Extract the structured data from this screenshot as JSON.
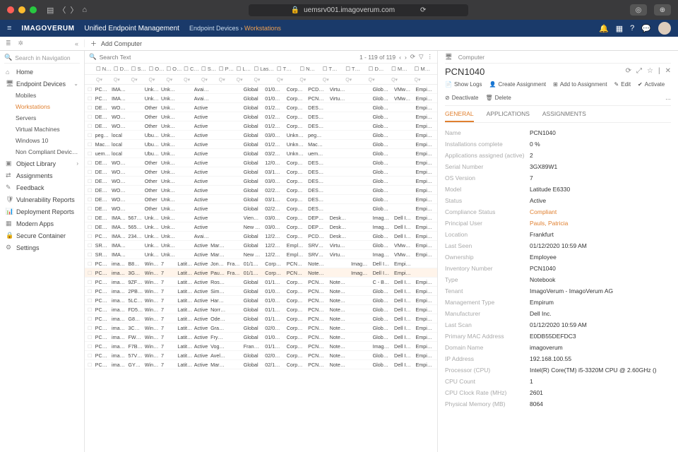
{
  "chrome": {
    "url": "uemsrv001.imagoverum.com"
  },
  "appbar": {
    "brand": "IMAGOVERUM",
    "title": "Unified Endpoint Management",
    "crumb1": "Endpoint Devices",
    "crumb2": "Workstations"
  },
  "add_button": "Add Computer",
  "search_placeholder": "Search in Navigation",
  "list_search": "Search Text",
  "paging": "1 - 119 of 119",
  "sidebar": {
    "home": "Home",
    "endpoint": "Endpoint Devices",
    "mobiles": "Mobiles",
    "workstations": "Workstations",
    "servers": "Servers",
    "vm": "Virtual Machines",
    "win10": "Windows 10",
    "noncomp": "Non Compliant Devic…",
    "objlib": "Object Library",
    "assign": "Assignments",
    "feedback": "Feedback",
    "vuln": "Vulnerability Reports",
    "deploy": "Deployment Reports",
    "modern": "Modern Apps",
    "secure": "Secure Container",
    "settings": "Settings"
  },
  "columns": [
    "N…",
    "D…",
    "S…",
    "O…",
    "O…",
    "C…",
    "S…",
    "P…",
    "L…",
    "Last…",
    "T…",
    "N…",
    "T…",
    "T…",
    "D…",
    "M…",
    "M…"
  ],
  "filter_ph": "Q▾",
  "rows": [
    [
      "PCD…",
      "IMA…",
      "",
      "Unkn…",
      "Unkn…",
      "",
      "Avail…",
      "",
      "",
      "Global",
      "01/0…",
      "Corp…",
      "PCD…",
      "Virtu…",
      "",
      "Glob…",
      "VMw…",
      "Empi…"
    ],
    [
      "PCN…",
      "IMA…",
      "",
      "Unkn…",
      "Unkn…",
      "",
      "Avail…",
      "",
      "",
      "Global",
      "01/0…",
      "Corp…",
      "PCN…",
      "Virtu…",
      "",
      "Glob…",
      "VMw…",
      "Empi…"
    ],
    [
      "DES…",
      "WOR…",
      "",
      "Other",
      "Unkn…",
      "",
      "Active",
      "",
      "",
      "Global",
      "01/2…",
      "Corp…",
      "DES…",
      "",
      "",
      "Glob…",
      "",
      "Empi…"
    ],
    [
      "DES…",
      "WOR…",
      "",
      "Other",
      "Unkn…",
      "",
      "Active",
      "",
      "",
      "Global",
      "01/2…",
      "Corp…",
      "DES…",
      "",
      "",
      "Glob…",
      "",
      "Empi…"
    ],
    [
      "DES…",
      "WOR…",
      "",
      "Other",
      "Unkn…",
      "",
      "Active",
      "",
      "",
      "Global",
      "01/2…",
      "Corp…",
      "DES…",
      "",
      "",
      "Glob…",
      "",
      "Empi…"
    ],
    [
      "peg…",
      "local",
      "",
      "Ubun…",
      "Unkn…",
      "",
      "Active",
      "",
      "",
      "Global",
      "03/0…",
      "Unkn…",
      "peg…",
      "",
      "",
      "Glob…",
      "",
      "Empi…"
    ],
    [
      "Mac…",
      "local",
      "",
      "Ubun…",
      "Unkn…",
      "",
      "Active",
      "",
      "",
      "Global",
      "01/2…",
      "Unkn…",
      "Mac…",
      "",
      "",
      "Glob…",
      "",
      "Empi…"
    ],
    [
      "uem…",
      "local",
      "",
      "Ubun…",
      "Unkn…",
      "",
      "Active",
      "",
      "",
      "Global",
      "03/2…",
      "Unkn…",
      "uem…",
      "",
      "",
      "Glob…",
      "",
      "Empi…"
    ],
    [
      "DES…",
      "WOR…",
      "",
      "Other",
      "Unkn…",
      "",
      "Active",
      "",
      "",
      "Global",
      "12/0…",
      "Corp…",
      "DES…",
      "",
      "",
      "Glob…",
      "",
      "Empi…"
    ],
    [
      "DES…",
      "WOR…",
      "",
      "Other",
      "Unkn…",
      "",
      "Active",
      "",
      "",
      "Global",
      "03/1…",
      "Corp…",
      "DES…",
      "",
      "",
      "Glob…",
      "",
      "Empi…"
    ],
    [
      "DES…",
      "WOR…",
      "",
      "Other",
      "Unkn…",
      "",
      "Active",
      "",
      "",
      "Global",
      "03/0…",
      "Corp…",
      "DES…",
      "",
      "",
      "Glob…",
      "",
      "Empi…"
    ],
    [
      "DES…",
      "WOR…",
      "",
      "Other",
      "Unkn…",
      "",
      "Active",
      "",
      "",
      "Global",
      "02/2…",
      "Corp…",
      "DES…",
      "",
      "",
      "Glob…",
      "",
      "Empi…"
    ],
    [
      "DES…",
      "WOR…",
      "",
      "Other",
      "Unkn…",
      "",
      "Active",
      "",
      "",
      "Global",
      "03/1…",
      "Corp…",
      "DES…",
      "",
      "",
      "Glob…",
      "",
      "Empi…"
    ],
    [
      "DES…",
      "WOR…",
      "",
      "Other",
      "Unkn…",
      "",
      "Active",
      "",
      "",
      "Global",
      "02/2…",
      "Corp…",
      "DES…",
      "",
      "",
      "Glob…",
      "",
      "Empi…"
    ],
    [
      "DEP…",
      "IMA…",
      "5675…",
      "Unkn…",
      "Unkn…",
      "",
      "Active",
      "",
      "",
      "Vien…",
      "03/0…",
      "Corp…",
      "DEP…",
      "Desk…",
      "",
      "Imag…",
      "Dell I…",
      "Empi…"
    ],
    [
      "DEP…",
      "IMA…",
      "5657…",
      "Unkn…",
      "Unkn…",
      "",
      "Active",
      "",
      "",
      "New …",
      "03/0…",
      "Corp…",
      "DEP…",
      "Desk…",
      "",
      "Imag…",
      "Dell I…",
      "Empi…"
    ],
    [
      "PCD…",
      "IMA…",
      "2344…",
      "Unkn…",
      "Unkn…",
      "",
      "Avail…",
      "",
      "",
      "Global",
      "12/2…",
      "Corp…",
      "PCD…",
      "Desk…",
      "",
      "Glob…",
      "Dell I…",
      "Empi…"
    ],
    [
      "SRV…",
      "IMA…",
      "",
      "Unkn…",
      "Unkn…",
      "",
      "Active",
      "Marv…",
      "",
      "Global",
      "12/2…",
      "Empl…",
      "SRV…",
      "Virtu…",
      "",
      "Glob…",
      "VMw…",
      "Empi…"
    ],
    [
      "SRV…",
      "IMA…",
      "",
      "Unkn…",
      "Unkn…",
      "",
      "Active",
      "Marv…",
      "",
      "New …",
      "12/2…",
      "Empl…",
      "SRV…",
      "Virtu…",
      "",
      "Imag…",
      "VMw…",
      "Empi…"
    ],
    [
      "PCN…",
      "imag…",
      "B8Q…",
      "Wind…",
      "7",
      "Latit…",
      "Active",
      "Jone…",
      "Fran…",
      "01/1…",
      "Corp…",
      "PCN…",
      "Note…",
      "",
      "Imag…",
      "Dell I…",
      "Empi…",
      ""
    ],
    [
      "PCN…",
      "imag…",
      "3GX…",
      "Wind…",
      "7",
      "Latit…",
      "Active",
      "Paul…",
      "Fran…",
      "01/1…",
      "Corp…",
      "PCN…",
      "Note…",
      "",
      "Imag…",
      "Dell I…",
      "Empi…",
      ""
    ],
    [
      "PCN…",
      "imag…",
      "9ZF3…",
      "Wind…",
      "7",
      "Latit…",
      "Active",
      "Ross…",
      "",
      "Global",
      "01/1…",
      "Corp…",
      "PCN…",
      "Note…",
      "",
      "C - B…",
      "Dell I…",
      "Empi…"
    ],
    [
      "PCN…",
      "imag…",
      "2PB…",
      "Wind…",
      "7",
      "Latit…",
      "Active",
      "Simp…",
      "",
      "Global",
      "01/0…",
      "Corp…",
      "PCN…",
      "Note…",
      "",
      "Glob…",
      "Dell I…",
      "Empi…"
    ],
    [
      "PCN…",
      "imag…",
      "5LC4…",
      "Wind…",
      "7",
      "Latit…",
      "Active",
      "Harv…",
      "",
      "Global",
      "01/0…",
      "Corp…",
      "PCN…",
      "Note…",
      "",
      "Glob…",
      "Dell I…",
      "Empi…"
    ],
    [
      "PCN…",
      "imag…",
      "FD5…",
      "Wind…",
      "7",
      "Latit…",
      "Active",
      "Norri…",
      "",
      "Global",
      "01/1…",
      "Corp…",
      "PCN…",
      "Note…",
      "",
      "Glob…",
      "Dell I…",
      "Empi…"
    ],
    [
      "PCN…",
      "imag…",
      "G8G…",
      "Wind…",
      "7",
      "Latit…",
      "Active",
      "Odell…",
      "",
      "Global",
      "01/1…",
      "Corp…",
      "PCN…",
      "Note…",
      "",
      "Glob…",
      "Dell I…",
      "Empi…"
    ],
    [
      "PCN…",
      "imag…",
      "3CN…",
      "Wind…",
      "7",
      "Latit…",
      "Active",
      "Gran…",
      "",
      "Global",
      "02/0…",
      "Corp…",
      "PCN…",
      "Note…",
      "",
      "Glob…",
      "Dell I…",
      "Empi…"
    ],
    [
      "PCN…",
      "imag…",
      "FW7…",
      "Wind…",
      "7",
      "Latit…",
      "Active",
      "Fryer…",
      "",
      "Global",
      "01/0…",
      "Corp…",
      "PCN…",
      "Note…",
      "",
      "Glob…",
      "Dell I…",
      "Empi…"
    ],
    [
      "PCN…",
      "imag…",
      "F7B4…",
      "Wind…",
      "7",
      "Latit…",
      "Active",
      "Voge…",
      "",
      "Fran…",
      "01/1…",
      "Corp…",
      "PCN…",
      "Note…",
      "",
      "Imag…",
      "Dell I…",
      "Empi…"
    ],
    [
      "PCN…",
      "imag…",
      "57V2…",
      "Wind…",
      "7",
      "Latit…",
      "Active",
      "Avel…",
      "",
      "Global",
      "02/0…",
      "Corp…",
      "PCN…",
      "Note…",
      "",
      "Glob…",
      "Dell I…",
      "Empi…"
    ],
    [
      "PCN…",
      "imag…",
      "GY2…",
      "Wind…",
      "7",
      "Latit…",
      "Active",
      "Mary…",
      "",
      "Global",
      "02/1…",
      "Corp…",
      "PCN…",
      "Note…",
      "",
      "Glob…",
      "Dell I…",
      "Empi…"
    ]
  ],
  "selected_row": 20,
  "detail": {
    "crumb": "Computer",
    "title": "PCN1040",
    "actions": {
      "show_logs": "Show Logs",
      "create_assign": "Create Assignment",
      "add_assign": "Add to Assignment",
      "edit": "Edit",
      "activate": "Activate",
      "deactivate": "Deactivate",
      "delete": "Delete"
    },
    "tabs": {
      "general": "GENERAL",
      "apps": "APPLICATIONS",
      "assigns": "ASSIGNMENTS"
    },
    "props": [
      {
        "k": "Name",
        "v": "PCN1040"
      },
      {
        "k": "Installations complete",
        "v": "0 %"
      },
      {
        "k": "Applications assigned (active)",
        "v": "2"
      },
      {
        "k": "Serial Number",
        "v": "3GX89W1"
      },
      {
        "k": "OS Version",
        "v": "7"
      },
      {
        "k": "Model",
        "v": "Latitude E6330"
      },
      {
        "k": "Status",
        "v": "Active"
      },
      {
        "k": "Compliance Status",
        "v": "Compliant",
        "link": true
      },
      {
        "k": "Principal User",
        "v": "Pauls, Patricia",
        "link": true
      },
      {
        "k": "Location",
        "v": "Frankfurt"
      },
      {
        "k": "Last Seen",
        "v": "01/12/2020 10:59 AM"
      },
      {
        "k": "Ownership",
        "v": "Employee"
      },
      {
        "k": "Inventory Number",
        "v": "PCN1040"
      },
      {
        "k": "Type",
        "v": "Notebook"
      },
      {
        "k": "Tenant",
        "v": "ImagoVerum - ImagoVerum AG"
      },
      {
        "k": "Management Type",
        "v": "Empirum"
      },
      {
        "k": "Manufacturer",
        "v": "Dell Inc."
      },
      {
        "k": "Last Scan",
        "v": "01/12/2020 10:59 AM"
      },
      {
        "k": "Primary MAC Address",
        "v": "E0DB55DEFDC3"
      },
      {
        "k": "Domain Name",
        "v": "imagoverum"
      },
      {
        "k": "IP Address",
        "v": "192.168.100.55"
      },
      {
        "k": "Processor (CPU)",
        "v": "Intel(R) Core(TM) i5-3320M CPU @ 2.60GHz ()"
      },
      {
        "k": "CPU Count",
        "v": "1"
      },
      {
        "k": "CPU Clock Rate (MHz)",
        "v": "2601"
      },
      {
        "k": "Physical Memory (MB)",
        "v": "8064"
      }
    ]
  }
}
